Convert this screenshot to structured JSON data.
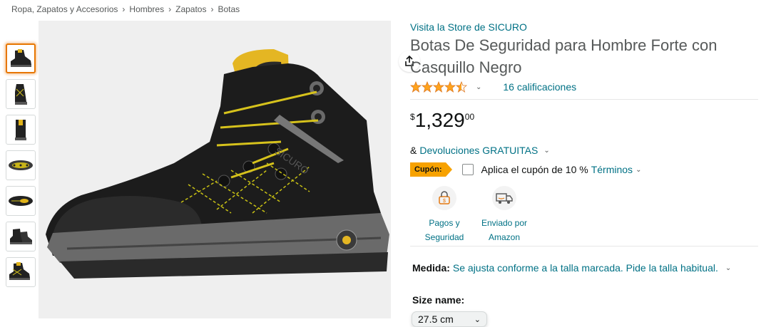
{
  "breadcrumb": [
    "Ropa, Zapatos y Accesorios",
    "Hombres",
    "Zapatos",
    "Botas"
  ],
  "breadcrumb_sep": "›",
  "store_link": "Visita la Store de SICURO",
  "title": "Botas De Seguridad para Hombre Forte con Casquillo Negro",
  "rating": {
    "stars": 4.5,
    "count_label": "16 calificaciones"
  },
  "price": {
    "symbol": "$",
    "whole": "1,329",
    "fraction": "00"
  },
  "returns": {
    "prefix": "&",
    "link": "Devoluciones GRATUITAS"
  },
  "coupon": {
    "badge": "Cupón:",
    "text": "Aplica el cupón de 10 %",
    "terms": "Términos"
  },
  "features": [
    {
      "icon": "secure-payment-icon",
      "line1": "Pagos y",
      "line2": "Seguridad"
    },
    {
      "icon": "shipping-truck-icon",
      "line1": "Enviado por",
      "line2": "Amazon"
    }
  ],
  "medida": {
    "label": "Medida:",
    "value": "Se ajusta conforme a la talla marcada. Pide la talla habitual."
  },
  "size": {
    "label": "Size name:",
    "selected": "27.5 cm"
  },
  "colors": {
    "link": "#007185",
    "coupon_badge": "#f7a200",
    "star": "#ffa41c",
    "thumb_selected": "#e77600"
  }
}
